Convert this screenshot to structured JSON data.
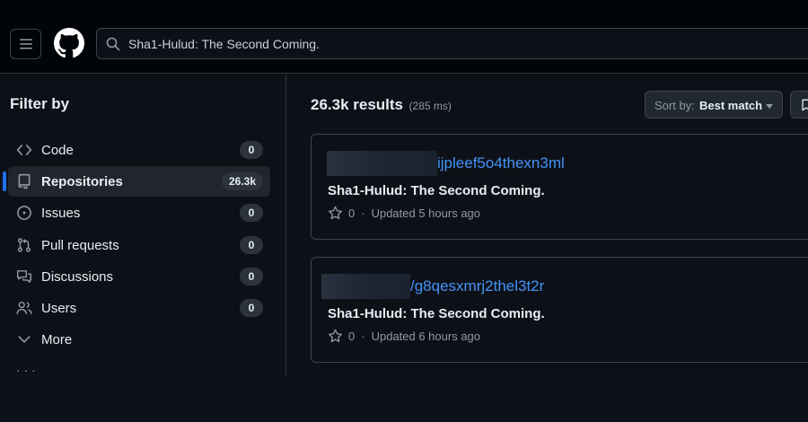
{
  "search": {
    "query": "Sha1-Hulud: The Second Coming."
  },
  "sidebar": {
    "title": "Filter by",
    "items": [
      {
        "label": "Code",
        "count": "0",
        "icon": "code-icon"
      },
      {
        "label": "Repositories",
        "count": "26.3k",
        "icon": "repo-icon",
        "active": true
      },
      {
        "label": "Issues",
        "count": "0",
        "icon": "issue-icon"
      },
      {
        "label": "Pull requests",
        "count": "0",
        "icon": "pull-request-icon"
      },
      {
        "label": "Discussions",
        "count": "0",
        "icon": "discussion-icon"
      },
      {
        "label": "Users",
        "count": "0",
        "icon": "people-icon"
      },
      {
        "label": "More",
        "icon": "chevron-down-icon"
      }
    ]
  },
  "results": {
    "count": "26.3k results",
    "time": "(285 ms)",
    "sort_prefix": "Sort by:",
    "sort_value": "Best match",
    "items": [
      {
        "repo_suffix": "ijpleef5o4thexn3ml",
        "description": "Sha1-Hulud: The Second Coming.",
        "stars": "0",
        "updated": "Updated 5 hours ago"
      },
      {
        "repo_suffix": "/g8qesxmrj2thel3t2r",
        "description": "Sha1-Hulud: The Second Coming.",
        "stars": "0",
        "updated": "Updated 6 hours ago"
      }
    ]
  },
  "colors": {
    "background": "#0d1117",
    "link": "#4493f8",
    "active_indicator": "#1f6feb",
    "border": "#3d444d"
  }
}
